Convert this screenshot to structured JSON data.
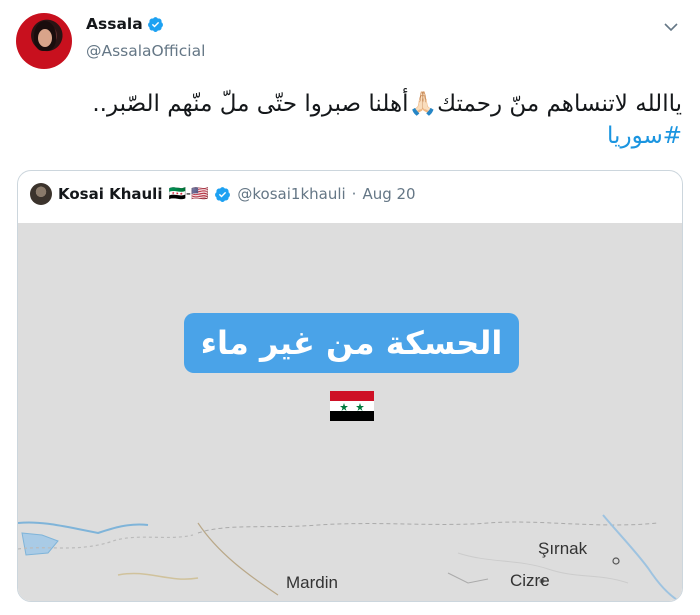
{
  "tweet": {
    "author_name": "Assala",
    "author_handle": "@AssalaOfficial",
    "text_main": "ياالله لاتنساهم منّ رحمتك🙏🏻أهلنا صبروا حتّى ملّ منّهم الصّبر.. ",
    "hashtag": "#سوريا"
  },
  "quoted_tweet": {
    "author_name": "Kosai Khauli",
    "flags": "🇸🇾-🇺🇸",
    "author_handle": "@kosai1khauli",
    "separator": "·",
    "date": "Aug 20",
    "media": {
      "overlay_text": "الحسكة من غير ماء",
      "map_labels": {
        "mardin": "Mardin",
        "sirnak": "Şırnak",
        "cizre": "Cizre"
      }
    }
  },
  "colors": {
    "verified": "#1da1f2",
    "hashtag": "#1b95e0",
    "overlay_pill": "#4aa3e8",
    "map_background": "#dddddd"
  },
  "icons": {
    "verified": "verified-badge-icon",
    "menu": "chevron-down-icon",
    "flag": "syria-flag-icon"
  }
}
